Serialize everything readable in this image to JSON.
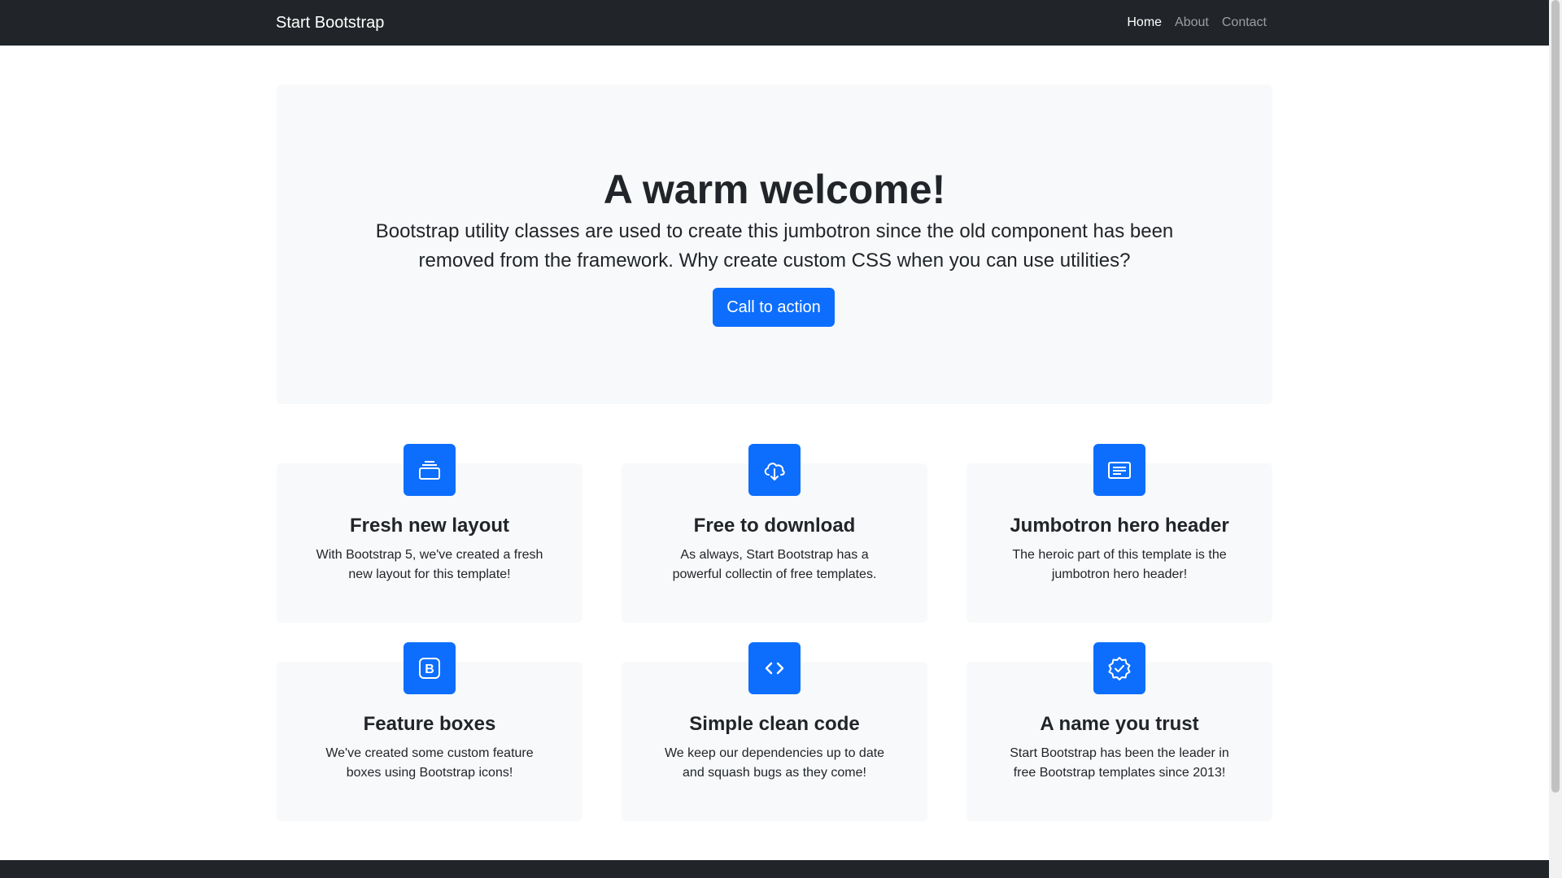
{
  "navbar": {
    "brand": "Start Bootstrap",
    "items": [
      {
        "label": "Home",
        "active": true
      },
      {
        "label": "About",
        "active": false
      },
      {
        "label": "Contact",
        "active": false
      }
    ]
  },
  "hero": {
    "title": "A warm welcome!",
    "lead": "Bootstrap utility classes are used to create this jumbotron since the old component has been removed from the framework. Why create custom CSS when you can use utilities?",
    "button": "Call to action"
  },
  "features": [
    {
      "icon": "collection-icon",
      "title": "Fresh new layout",
      "text": "With Bootstrap 5, we've created a fresh new layout for this template!"
    },
    {
      "icon": "cloud-download-icon",
      "title": "Free to download",
      "text": "As always, Start Bootstrap has a powerful collectin of free templates."
    },
    {
      "icon": "card-heading-icon",
      "title": "Jumbotron hero header",
      "text": "The heroic part of this template is the jumbotron hero header!"
    },
    {
      "icon": "bootstrap-icon",
      "title": "Feature boxes",
      "text": "We've created some custom feature boxes using Bootstrap icons!"
    },
    {
      "icon": "code-icon",
      "title": "Simple clean code",
      "text": "We keep our dependencies up to date and squash bugs as they come!"
    },
    {
      "icon": "patch-check-icon",
      "title": "A name you trust",
      "text": "Start Bootstrap has been the leader in free Bootstrap templates since 2013!"
    }
  ],
  "colors": {
    "navbar": "#212529",
    "hero_bg": "#f8f9fa",
    "primary": "#0d6efd",
    "text": "#212529"
  }
}
